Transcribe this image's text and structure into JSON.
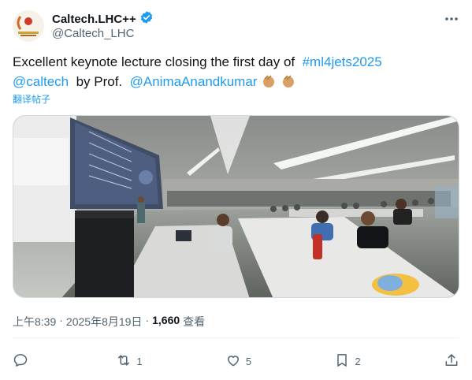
{
  "header": {
    "name": "Caltech.LHC++",
    "handle": "@Caltech_LHC",
    "verified_color": "#1d9bf0",
    "icons": [
      "verified-badge-icon",
      "more-icon"
    ]
  },
  "tweet": {
    "text_1": "Excellent keynote lecture closing the first day of",
    "hashtag": "#ml4jets2025",
    "mention_1": "@caltech",
    "text_2": "by Prof.",
    "mention_2": "@AnimaAnandkumar",
    "emoji_names": [
      "clapping-hands-icon",
      "clapping-hands-icon"
    ],
    "translate": "翻译帖子",
    "link_color": "#1d9bf0"
  },
  "media": {
    "alt": "Lecture hall with presenter and audience"
  },
  "meta": {
    "time": "上午8:39",
    "sep1": "·",
    "date": "2025年8月19日",
    "sep2": "·",
    "views": "1,660",
    "views_label": "查看"
  },
  "actions": {
    "reply": {
      "icon": "reply-icon",
      "count": ""
    },
    "retweet": {
      "icon": "retweet-icon",
      "count": "1"
    },
    "like": {
      "icon": "heart-icon",
      "count": "5"
    },
    "bookmark": {
      "icon": "bookmark-icon",
      "count": "2"
    },
    "share": {
      "icon": "share-icon",
      "count": ""
    }
  }
}
